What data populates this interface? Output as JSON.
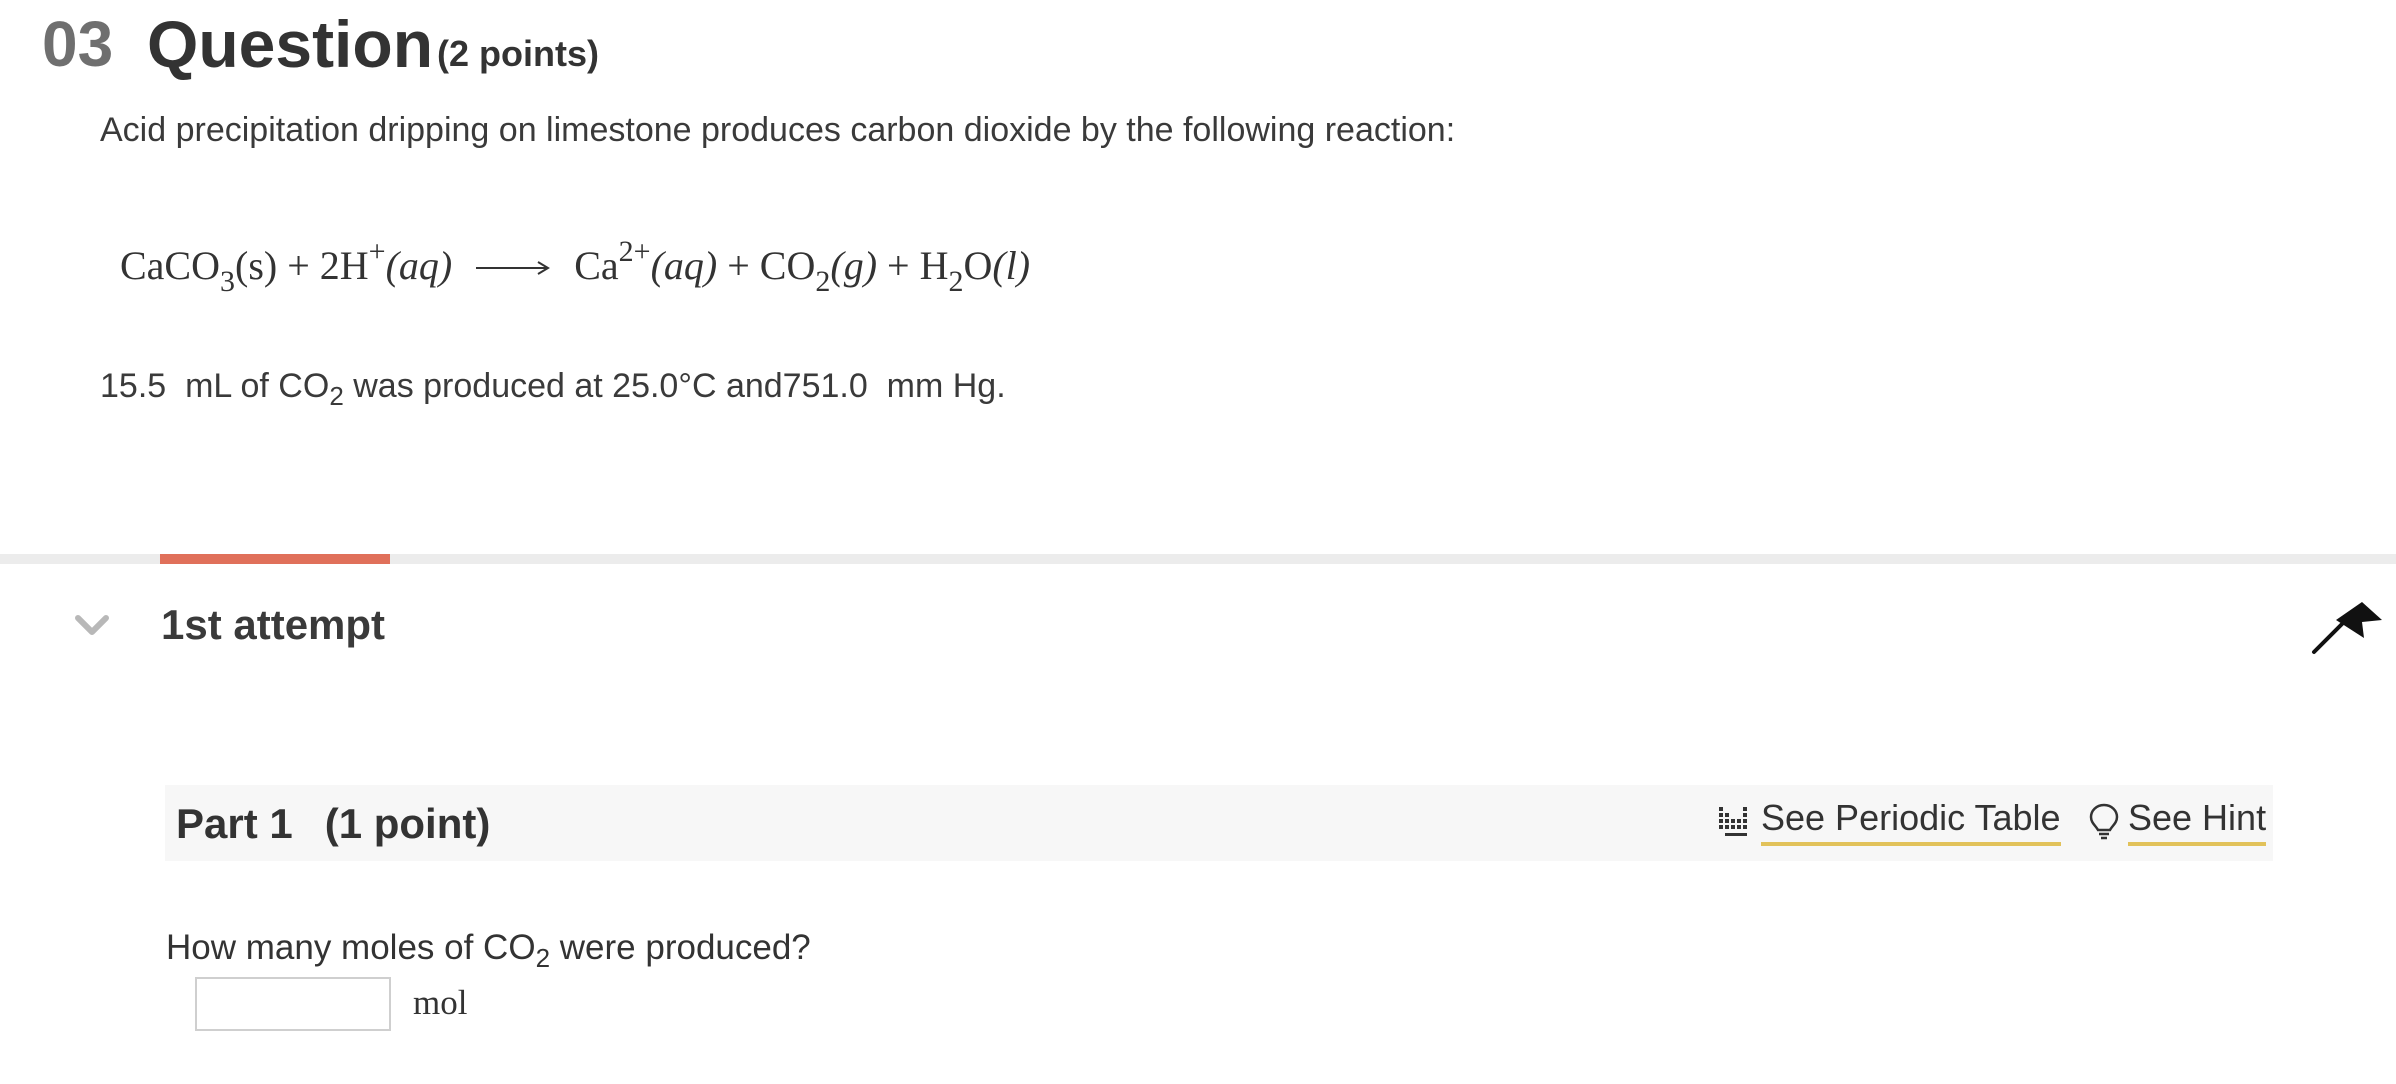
{
  "question": {
    "number": "03",
    "title": "Question",
    "points": "(2 points)",
    "intro": "Acid precipitation dripping on limestone produces carbon dioxide by the following reaction:",
    "equation": {
      "r1": "CaCO",
      "r1_sub": "3",
      "r1_state": "(s)",
      "plus1": "+",
      "r2": "2H",
      "r2_sup": "+",
      "r2_state": "(aq)",
      "p1": "Ca",
      "p1_sup": "2+",
      "p1_state": "(aq)",
      "plus2": "+",
      "p2": "CO",
      "p2_sub": "2",
      "p2_state": "(g)",
      "plus3": "+",
      "p3_a": "H",
      "p3_sub": "2",
      "p3_b": "O",
      "p3_state": "(l)"
    },
    "conditions": {
      "volume": "15.5",
      "before_sub": "mL of CO",
      "sub": "2",
      "middle": "was produced at 25.0°C and751.0",
      "end": "mm Hg."
    }
  },
  "attempt": {
    "label": "1st attempt",
    "progress_color": "#e0705a"
  },
  "part": {
    "label": "Part 1",
    "points": "(1 point)",
    "periodic_table_label": "See Periodic Table",
    "hint_label": "See Hint",
    "question_before": "How many moles of CO",
    "question_sub": "2",
    "question_after": "were produced?",
    "answer_value": "",
    "unit": "mol"
  },
  "icons": {
    "collapse": "chevron-down-icon",
    "flag": "flag-icon",
    "periodic_table": "periodic-table-icon",
    "hint": "lightbulb-icon"
  },
  "colors": {
    "accent_underline": "#e2c25a",
    "progress": "#e0705a"
  }
}
